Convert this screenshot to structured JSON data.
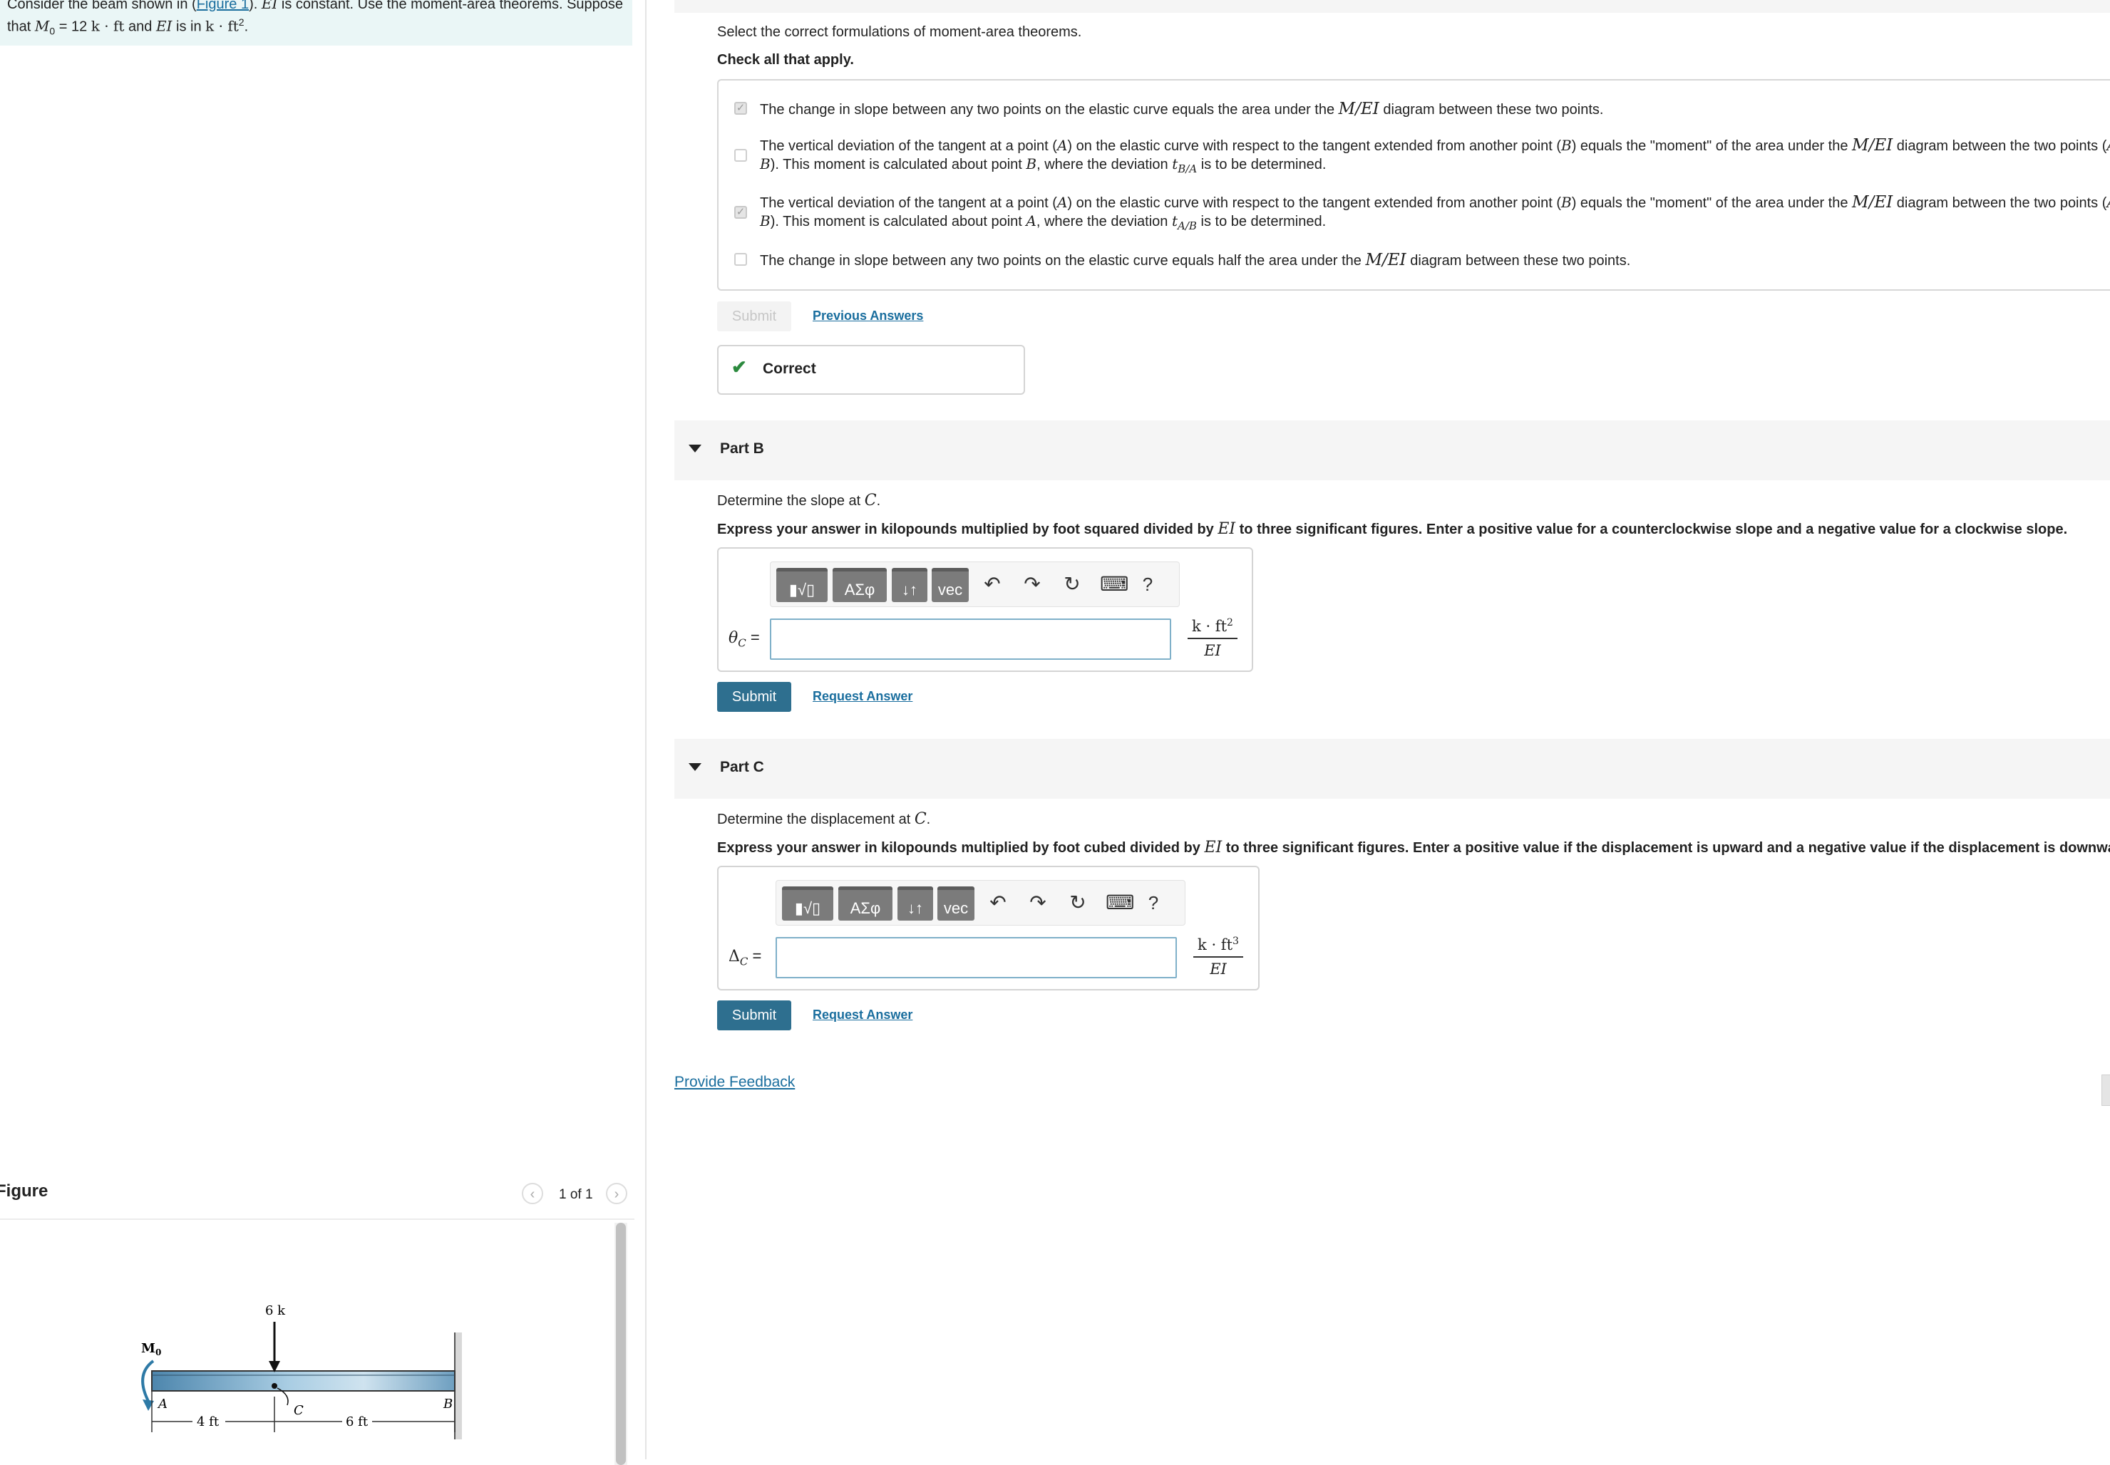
{
  "intro": {
    "line1_a": "Consider the beam shown in (",
    "figure_link": "Figure 1",
    "line1_b": "). ",
    "line1_ei": "EI",
    "line1_c": " is constant. Use the moment-area theorems. Suppose",
    "line2_a": "that ",
    "line2_m0": "M",
    "line2_m0_sub": "0",
    "line2_b": " = 12 ",
    "line2_units": "k · ft",
    "line2_c": " and ",
    "line2_ei": "EI",
    "line2_d": " is in ",
    "line2_units2": "k · ft",
    "line2_sup": "2",
    "line2_e": "."
  },
  "figure": {
    "title": "Figure",
    "page": "1 of 1",
    "prev_icon": "chevron-left-icon",
    "next_icon": "chevron-right-icon",
    "labels": {
      "moment": "M",
      "moment_sub": "0",
      "load": "6 k",
      "point_a": "A",
      "point_b": "B",
      "point_c": "C",
      "dim1": "4 ft",
      "dim2": "6 ft"
    }
  },
  "partA": {
    "prompt": "Select the correct formulations of moment-area theorems.",
    "instruction": "Check all that apply.",
    "choices": [
      {
        "checked": true,
        "line1": [
          "The change in slope between any two points on the elastic curve equals the area under the ",
          "M/EI",
          " diagram between these two points."
        ]
      },
      {
        "checked": false,
        "line1": [
          "The vertical deviation of the tangent at a point (",
          "A",
          ") on the elastic curve with respect to the tangent extended from another point (",
          "B",
          ") equals the \"moment\" of the area under the ",
          "M/EI",
          " diagram between the two points (",
          "A",
          " a"
        ],
        "line2": [
          "B",
          "). This moment is calculated about point ",
          "B",
          ", where the deviation ",
          "t",
          "B/A",
          " is to be determined."
        ]
      },
      {
        "checked": true,
        "line1": [
          "The vertical deviation of the tangent at a point (",
          "A",
          ") on the elastic curve with respect to the tangent extended from another point (",
          "B",
          ") equals the \"moment\" of the area under the ",
          "M/EI",
          " diagram between the two points (",
          "A",
          " a"
        ],
        "line2": [
          "B",
          "). This moment is calculated about point ",
          "A",
          ", where the deviation ",
          "t",
          "A/B",
          " is to be determined."
        ]
      },
      {
        "checked": false,
        "line1": [
          "The change in slope between any two points on the elastic curve equals half the area under the ",
          "M/EI",
          " diagram between these two points."
        ]
      }
    ],
    "submit_label": "Submit",
    "previous_answers": "Previous Answers",
    "feedback": "Correct"
  },
  "toolbar": {
    "templates": "▮√▯",
    "greek": "ΑΣφ",
    "arrows": "↓↑",
    "vec": "vec",
    "undo_icon": "undo-icon",
    "redo_icon": "redo-icon",
    "reset_icon": "reset-icon",
    "keyboard_icon": "keyboard-icon",
    "help": "?"
  },
  "partB": {
    "title": "Part B",
    "prompt_a": "Determine the slope at ",
    "prompt_var": "C",
    "prompt_b": ".",
    "instruction_a": "Express your answer in kilopounds multiplied by foot squared divided by ",
    "instruction_ei": "EI",
    "instruction_b": " to three significant figures. Enter a positive value for a counterclockwise slope and a negative value for a clockwise slope.",
    "label_var": "θ",
    "label_sub": "C",
    "label_eq": " =",
    "input_value": "",
    "unit_num": "k · ft",
    "unit_sup": "2",
    "unit_den": "EI",
    "submit_label": "Submit",
    "request_answer": "Request Answer"
  },
  "partC": {
    "title": "Part C",
    "prompt_a": "Determine the displacement at ",
    "prompt_var": "C",
    "prompt_b": ".",
    "instruction_a": "Express your answer in kilopounds multiplied by foot cubed divided by ",
    "instruction_ei": "EI",
    "instruction_b": " to three significant figures. Enter a positive value if the displacement is upward and a negative value if the displacement is downward.",
    "label_var": "Δ",
    "label_sub": "C",
    "label_eq": " =",
    "input_value": "",
    "unit_num": "k · ft",
    "unit_sup": "3",
    "unit_den": "EI",
    "submit_label": "Submit",
    "request_answer": "Request Answer"
  },
  "provide_feedback": "Provide Feedback",
  "colors": {
    "link": "#1a6e9e",
    "submit": "#2e6f8f",
    "correct": "#2c8a3e",
    "intro_bg": "#eaf6f6",
    "beam": "#7fb0cf"
  }
}
